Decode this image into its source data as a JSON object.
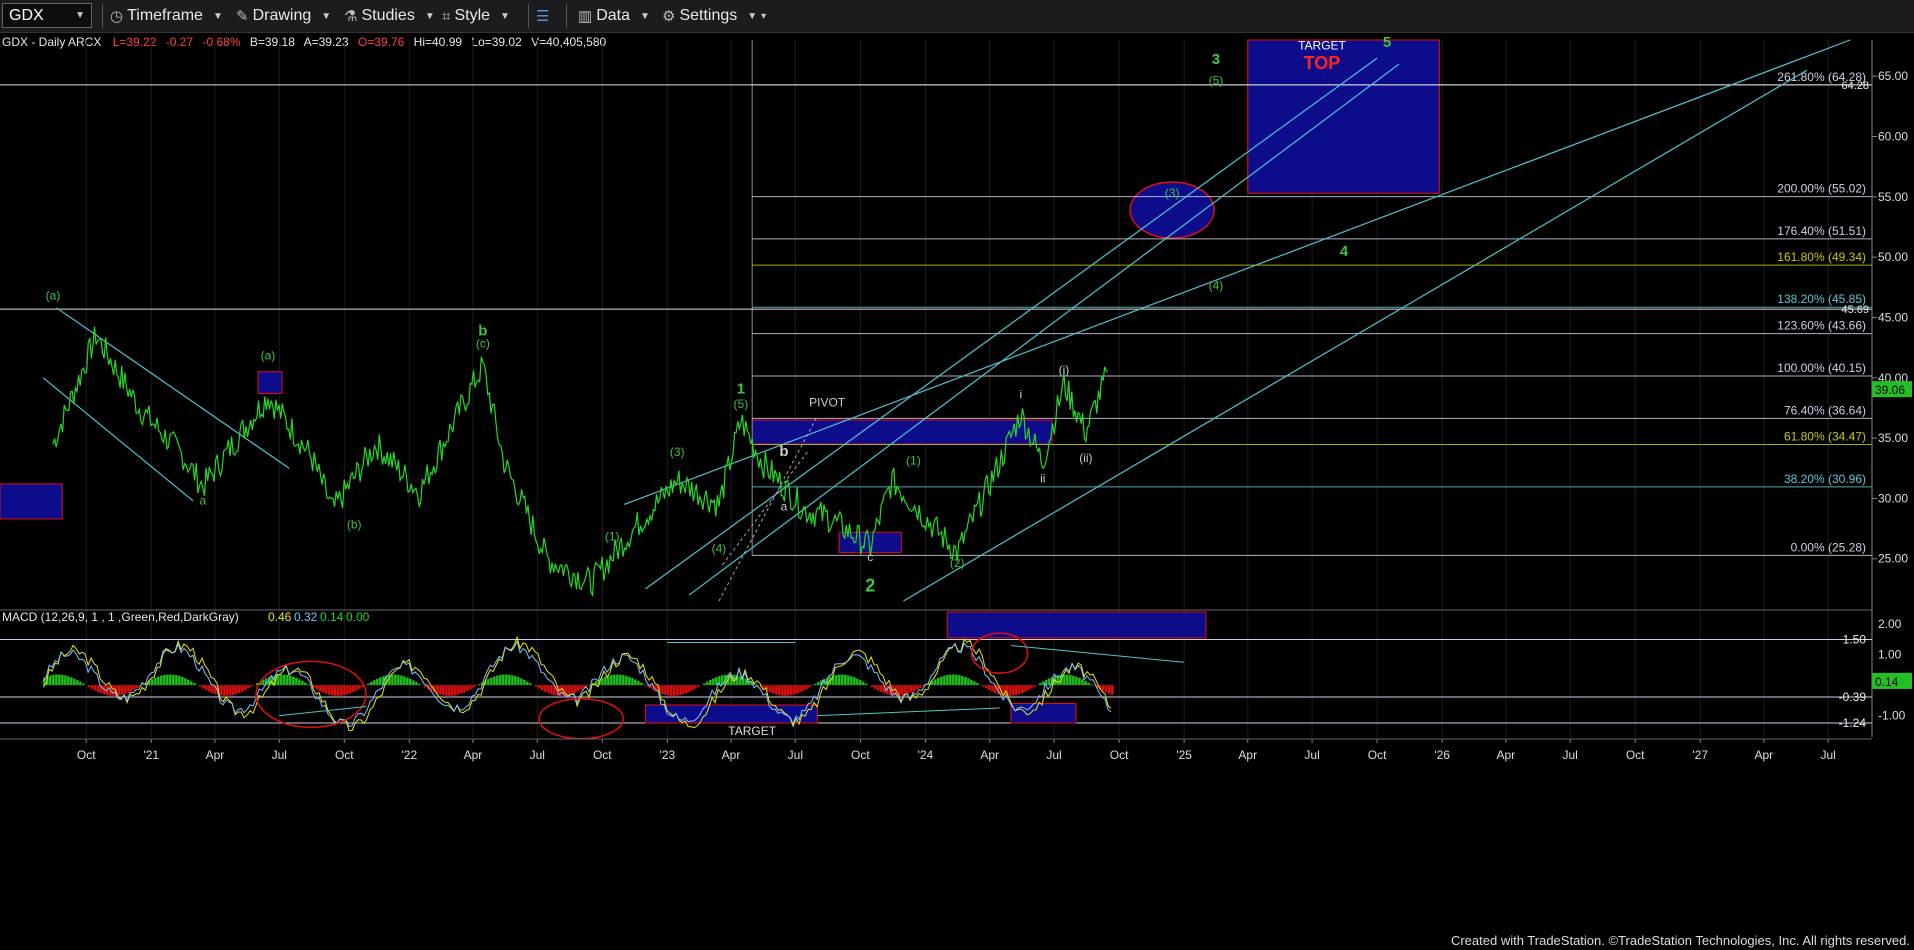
{
  "toolbar": {
    "symbol": "GDX",
    "items": [
      {
        "label": "Timeframe",
        "icon": "clock-icon"
      },
      {
        "label": "Drawing",
        "icon": "pencil-icon"
      },
      {
        "label": "Studies",
        "icon": "flask-icon"
      },
      {
        "label": "Style",
        "icon": "crosshair-icon"
      },
      {
        "label": "",
        "icon": "layout-icon"
      },
      {
        "label": "Data",
        "icon": "bar-chart-icon"
      },
      {
        "label": "Settings",
        "icon": "gear-icon"
      }
    ]
  },
  "header": {
    "name": "GDX - Daily  ARCX",
    "last": "L=39.22",
    "change": "-0.27",
    "pct": "-0.68%",
    "bid": "B=39.18",
    "ask": "A=39.23",
    "open": "O=39.76",
    "high": "Hi=40.99",
    "low": "Lo=39.02",
    "volume": "V=40,405,580"
  },
  "footer": "Created with TradeStation. ©TradeStation Technologies, Inc. All rights reserved.",
  "colors": {
    "price": "#27d827",
    "wave": "#3ec43e",
    "channel": "#4ec4d4",
    "box": "#0d0d8c",
    "red": "#e01010",
    "gridline": "#5a5a5a"
  },
  "chart_data": [
    {
      "type": "line",
      "title": "GDX - Daily",
      "y_ticks": [
        "25.00",
        "30.00",
        "35.00",
        "40.00",
        "45.00",
        "50.00",
        "55.00",
        "60.00",
        "65.00"
      ],
      "ylim": [
        21,
        68
      ],
      "x_ticks": [
        "Oct",
        "'21",
        "Apr",
        "Jul",
        "Oct",
        "'22",
        "Apr",
        "Jul",
        "Oct",
        "'23",
        "Apr",
        "Jul",
        "Oct",
        "'24",
        "Apr",
        "Jul",
        "Oct",
        "'25",
        "Apr",
        "Jul",
        "Oct",
        "'26",
        "Apr",
        "Jul",
        "Oct",
        "'27",
        "Apr",
        "Jul"
      ],
      "last_price_label": "39.06",
      "price_series": {
        "name": "GDX",
        "dates": [
          "2020-08",
          "2020-10",
          "2020-12",
          "2021-02",
          "2021-03",
          "2021-05",
          "2021-06",
          "2021-08",
          "2021-09",
          "2021-11",
          "2022-01",
          "2022-03",
          "2022-04",
          "2022-05",
          "2022-07",
          "2022-09",
          "2022-11",
          "2023-01",
          "2023-03",
          "2023-04",
          "2023-05",
          "2023-07",
          "2023-08",
          "2023-10",
          "2023-11",
          "2024-01",
          "2024-02",
          "2024-04",
          "2024-05",
          "2024-06",
          "2024-07",
          "2024-08",
          "2024-09"
        ],
        "values": [
          34.5,
          43.5,
          37.5,
          33.5,
          31.0,
          36.0,
          38.5,
          33.5,
          29.0,
          34.5,
          30.5,
          37.5,
          41.0,
          33.0,
          25.0,
          23.0,
          27.5,
          31.5,
          29.5,
          36.5,
          33.0,
          29.0,
          28.5,
          26.0,
          31.5,
          27.5,
          25.5,
          33.0,
          37.0,
          33.0,
          39.5,
          35.5,
          40.5
        ]
      },
      "fib_levels": [
        {
          "label": "261.80% (64.28)",
          "value": 64.28,
          "color": "#cfcfe8"
        },
        {
          "label": "200.00% (55.02)",
          "value": 55.02,
          "color": "#cfcfe8"
        },
        {
          "label": "176.40% (51.51)",
          "value": 51.51,
          "color": "#cfcfe8"
        },
        {
          "label": "161.80% (49.34)",
          "value": 49.34,
          "color": "#c8c800"
        },
        {
          "label": "138.20% (45.85)",
          "value": 45.85,
          "color": "#5bc8d8"
        },
        {
          "label": "123.60% (43.66)",
          "value": 43.66,
          "color": "#cfcfe8"
        },
        {
          "label": "100.00% (40.15)",
          "value": 40.15,
          "color": "#cfcfe8"
        },
        {
          "label": "76.40% (36.64)",
          "value": 36.64,
          "color": "#cfcfe8"
        },
        {
          "label": "61.80% (34.47)",
          "value": 34.47,
          "color": "#c8c800"
        },
        {
          "label": "38.20% (30.96)",
          "value": 30.96,
          "color": "#5bc8d8"
        },
        {
          "label": "0.00% (25.28)",
          "value": 25.28,
          "color": "#cfcfe8"
        }
      ],
      "horizontal_markers": [
        {
          "label": "64.28",
          "value": 64.28
        },
        {
          "label": "45.69",
          "value": 45.69
        }
      ],
      "wave_labels": [
        {
          "text": "(a)",
          "date": "2020-08",
          "value": 46.5,
          "color": "#3ec43e"
        },
        {
          "text": "a",
          "date": "2021-03",
          "value": 29.5,
          "color": "#3ec43e"
        },
        {
          "text": "(a)",
          "date": "2021-06",
          "value": 41.5,
          "color": "#3ec43e"
        },
        {
          "text": "(b)",
          "date": "2021-10",
          "value": 27.5,
          "color": "#3ec43e"
        },
        {
          "text": "b",
          "date": "2022-04",
          "value": 43.5,
          "color": "#3ec43e"
        },
        {
          "text": "(c)",
          "date": "2022-04",
          "value": 42.5,
          "color": "#3ec43e"
        },
        {
          "text": "(1)",
          "date": "2022-10",
          "value": 26.5,
          "color": "#3ec43e"
        },
        {
          "text": "(3)",
          "date": "2023-01",
          "value": 33.5,
          "color": "#3ec43e"
        },
        {
          "text": "(4)",
          "date": "2023-03",
          "value": 25.5,
          "color": "#3ec43e"
        },
        {
          "text": "(5)",
          "date": "2023-04",
          "value": 37.5,
          "color": "#3ec43e"
        },
        {
          "text": "1",
          "date": "2023-04",
          "value": 38.7,
          "color": "#3ec43e"
        },
        {
          "text": "PIVOT",
          "date": "2023-08",
          "value": 37.6,
          "color": "#cccccc"
        },
        {
          "text": "b",
          "date": "2023-06",
          "value": 33.5,
          "color": "#cccccc"
        },
        {
          "text": "a",
          "date": "2023-06",
          "value": 29.0,
          "color": "#cccccc"
        },
        {
          "text": "c",
          "date": "2023-10",
          "value": 24.8,
          "color": "#cccccc"
        },
        {
          "text": "2",
          "date": "2023-10",
          "value": 22.3,
          "color": "#3ec43e"
        },
        {
          "text": "(1)",
          "date": "2023-12",
          "value": 32.8,
          "color": "#3ec43e"
        },
        {
          "text": "(2)",
          "date": "2024-02",
          "value": 24.3,
          "color": "#3ec43e"
        },
        {
          "text": "i",
          "date": "2024-05",
          "value": 38.3,
          "color": "#cccccc"
        },
        {
          "text": "ii",
          "date": "2024-06",
          "value": 31.3,
          "color": "#cccccc"
        },
        {
          "text": "(i)",
          "date": "2024-07",
          "value": 40.3,
          "color": "#cccccc"
        },
        {
          "text": "(ii)",
          "date": "2024-08",
          "value": 33.0,
          "color": "#cccccc"
        },
        {
          "text": "(3)",
          "date": "2024-12",
          "value": 55.0,
          "color": "#3ec43e"
        },
        {
          "text": "(4)",
          "date": "2025-02",
          "value": 47.3,
          "color": "#3ec43e"
        },
        {
          "text": "4",
          "date": "2025-08",
          "value": 50.1,
          "color": "#3ec43e"
        },
        {
          "text": "3",
          "date": "2025-02",
          "value": 66.0,
          "color": "#3ec43e"
        },
        {
          "text": "(5)",
          "date": "2025-02",
          "value": 64.3,
          "color": "#3ec43e"
        },
        {
          "text": "5",
          "date": "2025-10",
          "value": 67.4,
          "color": "#3ec43e"
        },
        {
          "text": "TARGET",
          "date": "2025-07",
          "value": 67.2,
          "color": "#ffffff"
        },
        {
          "text": "TOP",
          "date": "2025-07",
          "value": 65.6,
          "color": "#ff2222"
        }
      ],
      "zones": [
        {
          "name": "target-top-zone",
          "from": "2025-04",
          "to": "2025-12",
          "low": 55.3,
          "high": 68.0
        },
        {
          "name": "pivot-zone",
          "from": "2023-05",
          "to": "2024-06",
          "low": 34.5,
          "high": 36.5
        },
        {
          "name": "wave-2-zone",
          "from": "2023-09",
          "to": "2023-11",
          "low": 25.5,
          "high": 27.2
        },
        {
          "name": "left-edge-zone",
          "from": "2020-06",
          "to": "2020-08",
          "low": 28.3,
          "high": 31.2
        },
        {
          "name": "wave-a-zone",
          "from": "2021-06",
          "to": "2021-06",
          "low": 38.7,
          "high": 40.5
        }
      ]
    },
    {
      "type": "line",
      "title": "MACD (12,26,9, 1 , 1 ,Green,Red,DarkGray)",
      "values_label": [
        "0.46",
        "0.32",
        "0.14",
        "0.00"
      ],
      "y_ticks": [
        "2.00",
        "1.00",
        "0.00",
        "-1.00"
      ],
      "ylim": [
        -1.7,
        2.4
      ],
      "levels": [
        {
          "label": "1.50",
          "value": 1.5
        },
        {
          "label": "-0.39",
          "value": -0.39
        },
        {
          "label": "-1.24",
          "value": -1.24
        }
      ],
      "last_value_label": "0.14",
      "target_label": "TARGET"
    }
  ]
}
